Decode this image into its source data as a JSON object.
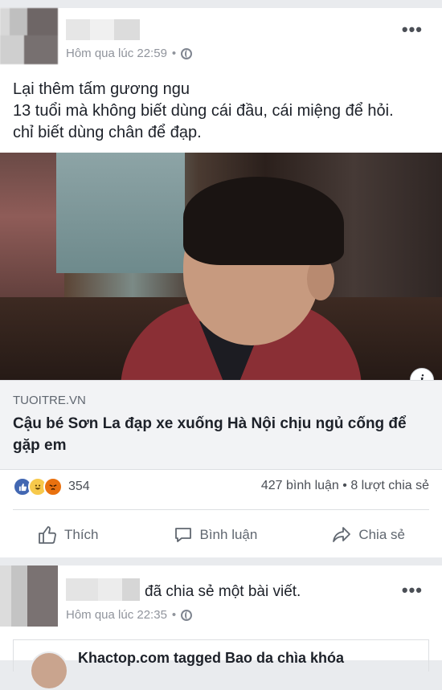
{
  "post1": {
    "timestamp": "Hôm qua lúc 22:59",
    "separator": "•",
    "more_label": "•••",
    "text_lines": [
      "Lại thêm tấm gương ngu",
      "13 tuổi mà không biết dùng cái đầu, cái miệng để hỏi.",
      "chỉ biết dùng chân để đạp."
    ],
    "info_label": "i",
    "link": {
      "domain": "TUOITRE.VN",
      "title": "Cậu bé Sơn La đạp xe xuống Hà Nội chịu ngủ cống để gặp em"
    },
    "reaction_count": "354",
    "counts_text": "427 bình luận • 8 lượt chia sẻ",
    "actions": {
      "like": "Thích",
      "comment": "Bình luận",
      "share": "Chia sẻ"
    }
  },
  "post2": {
    "shared_text": "đã chia sẻ một bài viết.",
    "timestamp": "Hôm qua lúc 22:35",
    "separator": "•",
    "more_label": "•••",
    "inner_text": "Khactop.com tagged Bao da chìa khóa"
  },
  "colors": {
    "background": "#e9ebee",
    "meta_text": "#90949c",
    "like_blue": "#4267b2"
  },
  "icons": {
    "globe": "globe-icon",
    "like": "thumbs-up-icon",
    "comment": "speech-bubble-icon",
    "share": "share-arrow-icon"
  }
}
